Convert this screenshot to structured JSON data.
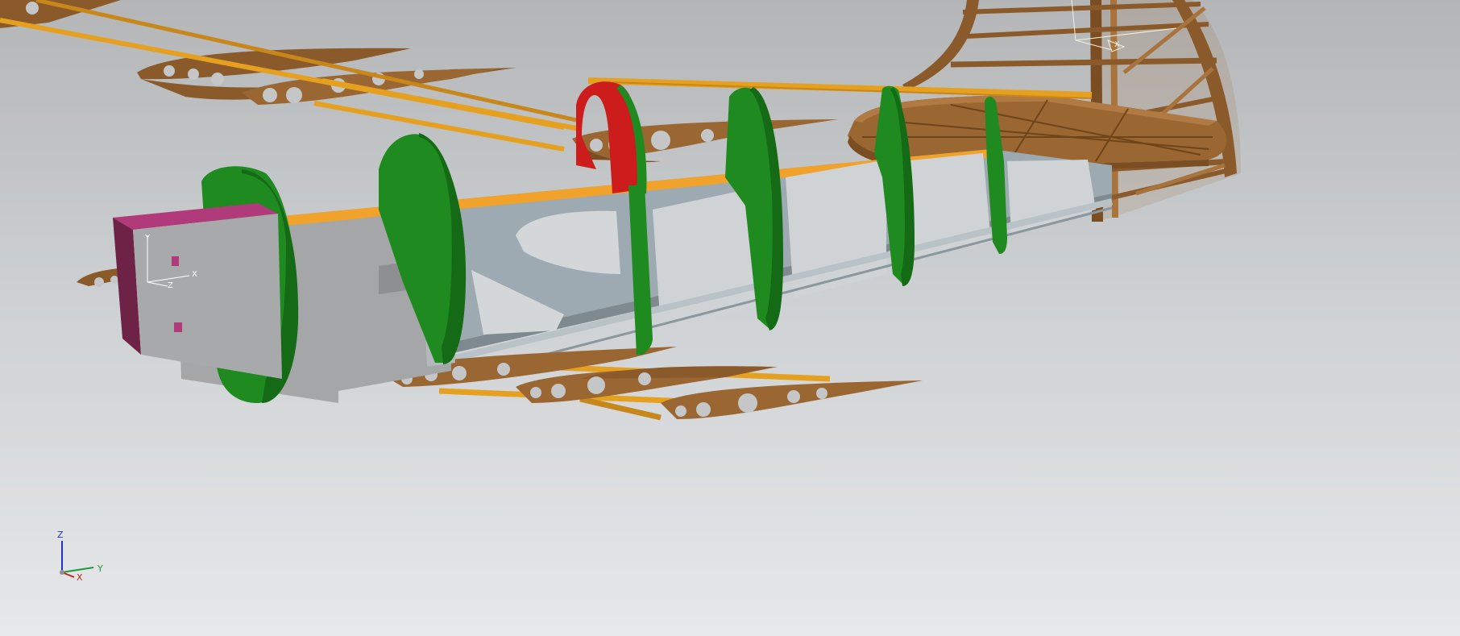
{
  "viewer": {
    "background_top": "#b3b5b7",
    "background_bottom": "#e6e8ea"
  },
  "colors": {
    "former_green": "#1f8a1f",
    "former_red": "#cc1c1c",
    "wood": "#8a5a2b",
    "wood_light": "#a8733d",
    "stringer": "#e6a020",
    "aluminum": "#9eaab1",
    "box_magenta": "#b03a7a",
    "box_gray": "#a8a9aa"
  },
  "part_triad": {
    "y_label": "Y",
    "z_label": "Z",
    "x_label": "X"
  },
  "tail_triad": {
    "label": "X"
  },
  "view_triad": {
    "z_label": "Z",
    "y_label": "Y",
    "x_label": "X",
    "icon": "view-orientation-triad-icon"
  }
}
